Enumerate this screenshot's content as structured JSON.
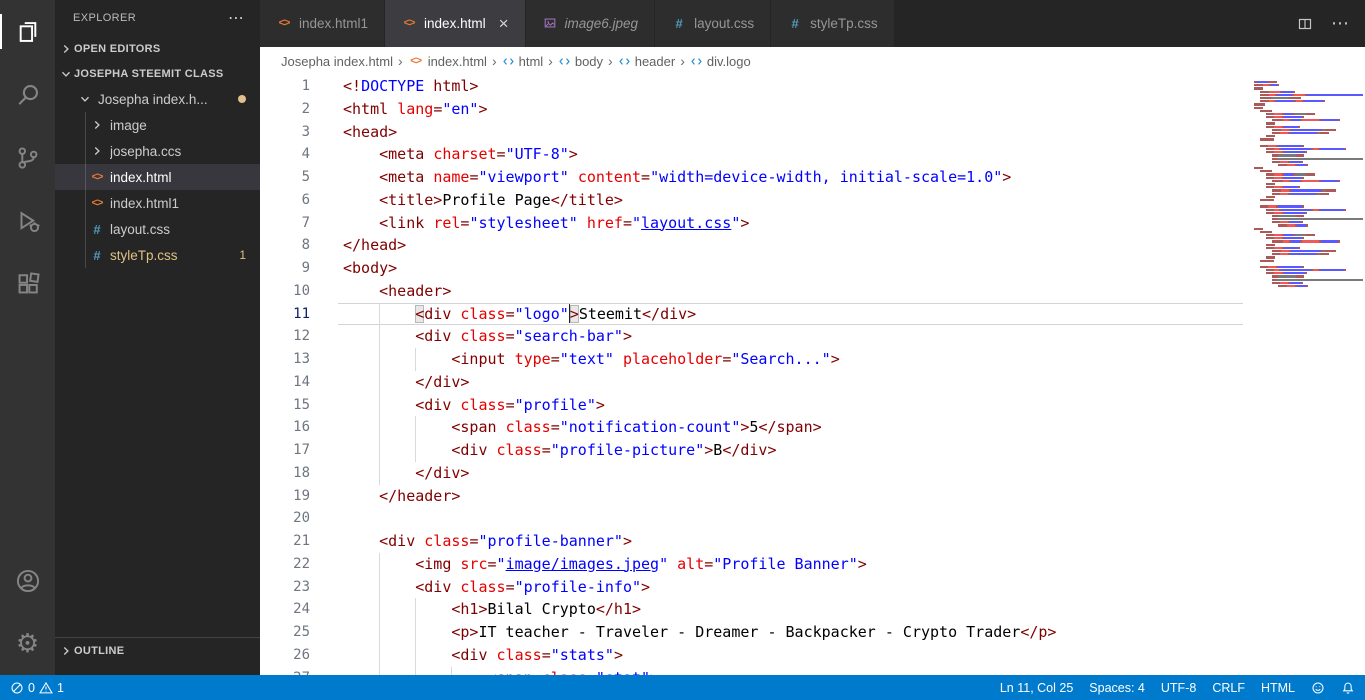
{
  "colors": {
    "statusbar_bg": "#007acc",
    "activitybar_bg": "#333333",
    "sidebar_bg": "#252526",
    "editor_bg": "#ffffff",
    "html_icon": "#e37933",
    "css_icon": "#519aba",
    "modified_dot": "#e2c08d",
    "warning_badge": "#e0c181",
    "tag_color": "#800000",
    "attribute_color": "#e50000",
    "string_color": "#0000ff"
  },
  "icons": {
    "settings_gear": "⚙",
    "more": "⋯",
    "close": "×",
    "html_file": "<>",
    "css_file": "#",
    "breadcrumb_separator": "›"
  },
  "activity_bar": {
    "items": [
      "explorer",
      "search",
      "source-control",
      "run-debug",
      "extensions"
    ],
    "bottom_items": [
      "account",
      "settings"
    ]
  },
  "sidebar": {
    "title": "EXPLORER",
    "open_editors_label": "OPEN EDITORS",
    "workspace_label": "JOSEPHA STEEMIT CLASS",
    "outline_label": "OUTLINE",
    "tree": [
      {
        "label": "Josepha index.h...",
        "kind": "folder",
        "expanded": true,
        "modified": true,
        "depth": 0
      },
      {
        "label": "image",
        "kind": "folder",
        "expanded": false,
        "depth": 1
      },
      {
        "label": "josepha.ccs",
        "kind": "folder",
        "expanded": false,
        "depth": 1
      },
      {
        "label": "index.html",
        "kind": "html",
        "depth": 1,
        "selected": true
      },
      {
        "label": "index.html1",
        "kind": "html",
        "depth": 1
      },
      {
        "label": "layout.css",
        "kind": "css",
        "depth": 1
      },
      {
        "label": "styleTp.css",
        "kind": "css",
        "depth": 1,
        "badge": "1",
        "warning": true
      }
    ]
  },
  "tab_bar": {
    "tabs": [
      {
        "label": "index.html1",
        "icon": "html",
        "active": false
      },
      {
        "label": "index.html",
        "icon": "html",
        "active": true,
        "close": true
      },
      {
        "label": "image6.jpeg",
        "icon": "image",
        "preview": true
      },
      {
        "label": "layout.css",
        "icon": "css"
      },
      {
        "label": "styleTp.css",
        "icon": "css"
      }
    ]
  },
  "breadcrumbs": [
    {
      "label": "Josepha index.html"
    },
    {
      "label": "index.html",
      "icon": "html-file"
    },
    {
      "label": "html",
      "icon": "symbol"
    },
    {
      "label": "body",
      "icon": "symbol"
    },
    {
      "label": "header",
      "icon": "symbol"
    },
    {
      "label": "div.logo",
      "icon": "symbol"
    }
  ],
  "editor": {
    "active_line": 11,
    "cursor": {
      "line": 11,
      "col": 25
    },
    "lines": [
      [
        [
          "t",
          "<!"
        ],
        [
          "d",
          "DOCTYPE"
        ],
        [
          "t",
          " html>"
        ]
      ],
      [
        [
          "t",
          "<html "
        ],
        [
          "a",
          "lang"
        ],
        [
          "t",
          "="
        ],
        [
          "s",
          "\"en\""
        ],
        [
          "t",
          ">"
        ]
      ],
      [
        [
          "t",
          "<head>"
        ]
      ],
      [
        [
          "w",
          "    "
        ],
        [
          "t",
          "<meta "
        ],
        [
          "a",
          "charset"
        ],
        [
          "t",
          "="
        ],
        [
          "s",
          "\"UTF-8\""
        ],
        [
          "t",
          ">"
        ]
      ],
      [
        [
          "w",
          "    "
        ],
        [
          "t",
          "<meta "
        ],
        [
          "a",
          "name"
        ],
        [
          "t",
          "="
        ],
        [
          "s",
          "\"viewport\""
        ],
        [
          "t",
          " "
        ],
        [
          "a",
          "content"
        ],
        [
          "t",
          "="
        ],
        [
          "s",
          "\"width=device-width, initial-scale=1.0\""
        ],
        [
          "t",
          ">"
        ]
      ],
      [
        [
          "w",
          "    "
        ],
        [
          "t",
          "<title>"
        ],
        [
          "x",
          "Profile Page"
        ],
        [
          "t",
          "</title>"
        ]
      ],
      [
        [
          "w",
          "    "
        ],
        [
          "t",
          "<link "
        ],
        [
          "a",
          "rel"
        ],
        [
          "t",
          "="
        ],
        [
          "s",
          "\"stylesheet\""
        ],
        [
          "t",
          " "
        ],
        [
          "a",
          "href"
        ],
        [
          "t",
          "="
        ],
        [
          "s",
          "\""
        ],
        [
          "u",
          "layout.css"
        ],
        [
          "s",
          "\""
        ],
        [
          "t",
          ">"
        ]
      ],
      [
        [
          "t",
          "</head>"
        ]
      ],
      [
        [
          "t",
          "<body>"
        ]
      ],
      [
        [
          "w",
          "    "
        ],
        [
          "t",
          "<header>"
        ]
      ],
      [
        [
          "w",
          "        "
        ],
        [
          "tm",
          "<"
        ],
        [
          "t",
          "div "
        ],
        [
          "a",
          "class"
        ],
        [
          "t",
          "="
        ],
        [
          "s",
          "\"logo\""
        ],
        [
          "cur",
          ""
        ],
        [
          "tm",
          ">"
        ],
        [
          "x",
          "Steemit"
        ],
        [
          "t",
          "</div>"
        ]
      ],
      [
        [
          "w",
          "        "
        ],
        [
          "t",
          "<div "
        ],
        [
          "a",
          "class"
        ],
        [
          "t",
          "="
        ],
        [
          "s",
          "\"search-bar\""
        ],
        [
          "t",
          ">"
        ]
      ],
      [
        [
          "w",
          "            "
        ],
        [
          "t",
          "<input "
        ],
        [
          "a",
          "type"
        ],
        [
          "t",
          "="
        ],
        [
          "s",
          "\"text\""
        ],
        [
          "t",
          " "
        ],
        [
          "a",
          "placeholder"
        ],
        [
          "t",
          "="
        ],
        [
          "s",
          "\"Search...\""
        ],
        [
          "t",
          ">"
        ]
      ],
      [
        [
          "w",
          "        "
        ],
        [
          "t",
          "</div>"
        ]
      ],
      [
        [
          "w",
          "        "
        ],
        [
          "t",
          "<div "
        ],
        [
          "a",
          "class"
        ],
        [
          "t",
          "="
        ],
        [
          "s",
          "\"profile\""
        ],
        [
          "t",
          ">"
        ]
      ],
      [
        [
          "w",
          "            "
        ],
        [
          "t",
          "<span "
        ],
        [
          "a",
          "class"
        ],
        [
          "t",
          "="
        ],
        [
          "s",
          "\"notification-count\""
        ],
        [
          "t",
          ">"
        ],
        [
          "x",
          "5"
        ],
        [
          "t",
          "</span>"
        ]
      ],
      [
        [
          "w",
          "            "
        ],
        [
          "t",
          "<div "
        ],
        [
          "a",
          "class"
        ],
        [
          "t",
          "="
        ],
        [
          "s",
          "\"profile-picture\""
        ],
        [
          "t",
          ">"
        ],
        [
          "x",
          "B"
        ],
        [
          "t",
          "</div>"
        ]
      ],
      [
        [
          "w",
          "        "
        ],
        [
          "t",
          "</div>"
        ]
      ],
      [
        [
          "w",
          "    "
        ],
        [
          "t",
          "</header>"
        ]
      ],
      [],
      [
        [
          "w",
          "    "
        ],
        [
          "t",
          "<div "
        ],
        [
          "a",
          "class"
        ],
        [
          "t",
          "="
        ],
        [
          "s",
          "\"profile-banner\""
        ],
        [
          "t",
          ">"
        ]
      ],
      [
        [
          "w",
          "        "
        ],
        [
          "t",
          "<img "
        ],
        [
          "a",
          "src"
        ],
        [
          "t",
          "="
        ],
        [
          "s",
          "\""
        ],
        [
          "u",
          "image/images.jpeg"
        ],
        [
          "s",
          "\""
        ],
        [
          "t",
          " "
        ],
        [
          "a",
          "alt"
        ],
        [
          "t",
          "="
        ],
        [
          "s",
          "\"Profile Banner\""
        ],
        [
          "t",
          ">"
        ]
      ],
      [
        [
          "w",
          "        "
        ],
        [
          "t",
          "<div "
        ],
        [
          "a",
          "class"
        ],
        [
          "t",
          "="
        ],
        [
          "s",
          "\"profile-info\""
        ],
        [
          "t",
          ">"
        ]
      ],
      [
        [
          "w",
          "            "
        ],
        [
          "t",
          "<h1>"
        ],
        [
          "x",
          "Bilal Crypto"
        ],
        [
          "t",
          "</h1>"
        ]
      ],
      [
        [
          "w",
          "            "
        ],
        [
          "t",
          "<p>"
        ],
        [
          "x",
          "IT teacher - Traveler - Dreamer - Backpacker - Crypto Trader"
        ],
        [
          "t",
          "</p>"
        ]
      ],
      [
        [
          "w",
          "            "
        ],
        [
          "t",
          "<div "
        ],
        [
          "a",
          "class"
        ],
        [
          "t",
          "="
        ],
        [
          "s",
          "\"stats\""
        ],
        [
          "t",
          ">"
        ]
      ],
      [
        [
          "w",
          "                "
        ],
        [
          "t",
          "<span "
        ],
        [
          "a",
          "class"
        ],
        [
          "t",
          "="
        ],
        [
          "s",
          "\"stat\""
        ],
        [
          "t",
          ">"
        ]
      ]
    ]
  },
  "status_bar": {
    "errors": "0",
    "warnings": "1",
    "items": [
      {
        "name": "cursor-position",
        "label": "Ln 11, Col 25"
      },
      {
        "name": "indentation",
        "label": "Spaces: 4"
      },
      {
        "name": "encoding",
        "label": "UTF-8"
      },
      {
        "name": "eol",
        "label": "CRLF"
      },
      {
        "name": "language-mode",
        "label": "HTML"
      }
    ]
  }
}
